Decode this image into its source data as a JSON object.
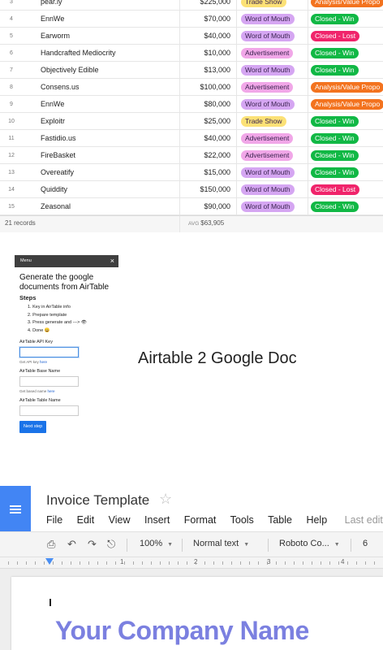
{
  "grid": {
    "rows": [
      {
        "num": "3",
        "name": "pear.ly",
        "amount": "$225,000",
        "source": "Trade Show",
        "status": "Analysis/Value Propo"
      },
      {
        "num": "4",
        "name": "EnnWe",
        "amount": "$70,000",
        "source": "Word of Mouth",
        "status": "Closed - Win"
      },
      {
        "num": "5",
        "name": "Earworm",
        "amount": "$40,000",
        "source": "Word of Mouth",
        "status": "Closed - Lost"
      },
      {
        "num": "6",
        "name": "Handcrafted Mediocrity",
        "amount": "$10,000",
        "source": "Advertisement",
        "status": "Closed - Win"
      },
      {
        "num": "7",
        "name": "Objectively Edible",
        "amount": "$13,000",
        "source": "Word of Mouth",
        "status": "Closed - Win"
      },
      {
        "num": "8",
        "name": "Consens.us",
        "amount": "$100,000",
        "source": "Advertisement",
        "status": "Analysis/Value Propo"
      },
      {
        "num": "9",
        "name": "EnnWe",
        "amount": "$80,000",
        "source": "Word of Mouth",
        "status": "Analysis/Value Propo"
      },
      {
        "num": "10",
        "name": "Exploitr",
        "amount": "$25,000",
        "source": "Trade Show",
        "status": "Closed - Win"
      },
      {
        "num": "11",
        "name": "Fastidio.us",
        "amount": "$40,000",
        "source": "Advertisement",
        "status": "Closed - Win"
      },
      {
        "num": "12",
        "name": "FireBasket",
        "amount": "$22,000",
        "source": "Advertisement",
        "status": "Closed - Win"
      },
      {
        "num": "13",
        "name": "Overeatify",
        "amount": "$15,000",
        "source": "Word of Mouth",
        "status": "Closed - Win"
      },
      {
        "num": "14",
        "name": "Quiddity",
        "amount": "$150,000",
        "source": "Word of Mouth",
        "status": "Closed - Lost"
      },
      {
        "num": "15",
        "name": "Zeasonal",
        "amount": "$90,000",
        "source": "Word of Mouth",
        "status": "Closed - Win"
      }
    ],
    "footer": {
      "record_count": "21 records",
      "avg_label": "AVG",
      "avg_value": "$63,905"
    },
    "colors": {
      "Trade Show": "#fce176",
      "Word of Mouth": "#d5a6f2",
      "Advertisement": "#f1a7e8",
      "Closed - Win": "#11b845",
      "Closed - Lost": "#f0246b",
      "Analysis/Value Propo": "#f3731f"
    }
  },
  "sidebar": {
    "menu_label": "Menu",
    "close_icon": "×",
    "title": "Generate the google documents from AirTable",
    "steps_heading": "Steps",
    "steps": [
      "1. Key in AirTable info",
      "2. Prepare template",
      "3. Press generate and ---> 👁",
      "4. Done 😀"
    ],
    "api_key_label": "AirTable API Key",
    "api_key_hint": "Get API key",
    "api_key_link": "here",
    "base_name_label": "AirTable Base Name",
    "base_name_hint": "Get based name",
    "base_name_link": "here",
    "table_name_label": "AirTable Table Name",
    "next_button": "Next step"
  },
  "heading": "Airtable 2 Google Doc",
  "doc": {
    "title": "Invoice Template",
    "star": "☆",
    "menu": [
      "File",
      "Edit",
      "View",
      "Insert",
      "Format",
      "Tools",
      "Table",
      "Help"
    ],
    "last_edit": "Last edit wa",
    "zoom": "100%",
    "style": "Normal text",
    "font": "Roboto Co...",
    "font_size": "6",
    "ruler_labels": [
      "1",
      "2",
      "3",
      "4"
    ],
    "company_name": "Your Company Name",
    "company_color": "#7b80e0",
    "accent": "#4285f4"
  }
}
